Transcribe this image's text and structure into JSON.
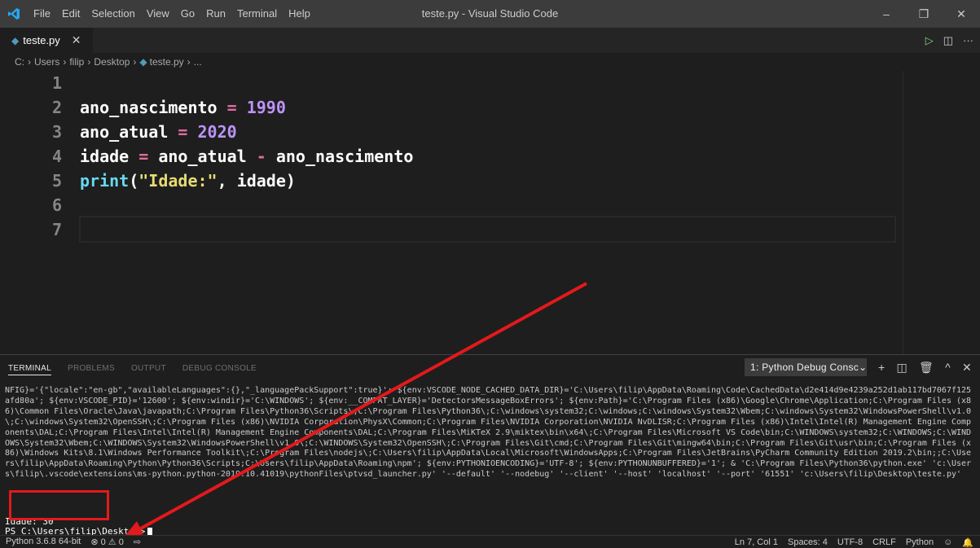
{
  "titlebar": {
    "menu": [
      "File",
      "Edit",
      "Selection",
      "View",
      "Go",
      "Run",
      "Terminal",
      "Help"
    ],
    "window_title": "teste.py - Visual Studio Code",
    "controls": {
      "minimize": "–",
      "maximize": "❐",
      "close": "✕"
    }
  },
  "tab": {
    "label": "teste.py",
    "close": "✕"
  },
  "editor_actions": {
    "run": "▷",
    "split": "◫",
    "more": "···"
  },
  "breadcrumb": [
    "C:",
    "Users",
    "filip",
    "Desktop",
    "teste.py",
    "..."
  ],
  "editor": {
    "line_numbers": [
      "1",
      "2",
      "3",
      "4",
      "5",
      "6",
      "7"
    ],
    "lines": [
      [],
      [
        {
          "t": "var",
          "v": "ano_nascimento "
        },
        {
          "t": "op",
          "v": "="
        },
        {
          "t": "var",
          "v": " "
        },
        {
          "t": "num",
          "v": "1990"
        }
      ],
      [
        {
          "t": "var",
          "v": "ano_atual "
        },
        {
          "t": "op",
          "v": "="
        },
        {
          "t": "var",
          "v": " "
        },
        {
          "t": "num",
          "v": "2020"
        }
      ],
      [
        {
          "t": "var",
          "v": "idade "
        },
        {
          "t": "op",
          "v": "="
        },
        {
          "t": "var",
          "v": " ano_atual "
        },
        {
          "t": "op",
          "v": "-"
        },
        {
          "t": "var",
          "v": " ano_nascimento"
        }
      ],
      [
        {
          "t": "fn",
          "v": "print"
        },
        {
          "t": "pun",
          "v": "("
        },
        {
          "t": "str",
          "v": "\"Idade:\""
        },
        {
          "t": "pun",
          "v": ", "
        },
        {
          "t": "var",
          "v": "idade"
        },
        {
          "t": "pun",
          "v": ")"
        }
      ],
      [],
      []
    ]
  },
  "panel": {
    "tabs": [
      "TERMINAL",
      "PROBLEMS",
      "OUTPUT",
      "DEBUG CONSOLE"
    ],
    "active_tab": "TERMINAL",
    "terminal_select": "1: Python Debug Consc",
    "actions": {
      "add": "+",
      "split": "◫",
      "trash": "🗑",
      "maximize": "^",
      "close": "✕"
    },
    "terminal_text": "NFIG}='{\"locale\":\"en-gb\",\"availableLanguages\":{},\"_languagePackSupport\":true}'; ${env:VSCODE_NODE_CACHED_DATA_DIR}='C:\\Users\\filip\\AppData\\Roaming\\Code\\CachedData\\d2e414d9e4239a252d1ab117bd7067f125afd80a'; ${env:VSCODE_PID}='12600'; ${env:windir}='C:\\WINDOWS'; ${env:__COMPAT_LAYER}='DetectorsMessageBoxErrors'; ${env:Path}='C:\\Program Files (x86)\\Google\\Chrome\\Application;C:\\Program Files (x86)\\Common Files\\Oracle\\Java\\javapath;C:\\Program Files\\Python36\\Scripts\\;C:\\Program Files\\Python36\\;C:\\windows\\system32;C:\\windows;C:\\windows\\System32\\Wbem;C:\\windows\\System32\\WindowsPowerShell\\v1.0\\;C:\\windows\\System32\\OpenSSH\\;C:\\Program Files (x86)\\NVIDIA Corporation\\PhysX\\Common;C:\\Program Files\\NVIDIA Corporation\\NVIDIA NvDLISR;C:\\Program Files (x86)\\Intel\\Intel(R) Management Engine Components\\DAL;C:\\Program Files\\Intel\\Intel(R) Management Engine Components\\DAL;C:\\Program Files\\MiKTeX 2.9\\miktex\\bin\\x64\\;C:\\Program Files\\Microsoft VS Code\\bin;C:\\WINDOWS\\system32;C:\\WINDOWS;C:\\WINDOWS\\System32\\Wbem;C:\\WINDOWS\\System32\\WindowsPowerShell\\v1.0\\;C:\\WINDOWS\\System32\\OpenSSH\\;C:\\Program Files\\Git\\cmd;C:\\Program Files\\Git\\mingw64\\bin;C:\\Program Files\\Git\\usr\\bin;C:\\Program Files (x86)\\Windows Kits\\8.1\\Windows Performance Toolkit\\;C:\\Program Files\\nodejs\\;C:\\Users\\filip\\AppData\\Local\\Microsoft\\WindowsApps;C:\\Program Files\\JetBrains\\PyCharm Community Edition 2019.2\\bin;;C:\\Users\\filip\\AppData\\Roaming\\Python\\Python36\\Scripts;C:\\Users\\filip\\AppData\\Roaming\\npm'; ${env:PYTHONIOENCODING}='UTF-8'; ${env:PYTHONUNBUFFERED}='1'; & 'C:\\Program Files\\Python36\\python.exe' 'c:\\Users\\filip\\.vscode\\extensions\\ms-python.python-2019.10.41019\\pythonFiles\\ptvsd_launcher.py' '--default' '--nodebug' '--client' '--host' 'localhost' '--port' '61551' 'c:\\Users\\filip\\Desktop\\teste.py'",
    "output_line": "Idade: 30",
    "prompt": "PS C:\\Users\\filip\\Desktop>"
  },
  "statusbar": {
    "left": [
      "Python 3.6.8 64-bit",
      "⊗ 0 ⚠ 0",
      "⇨"
    ],
    "right": [
      "Ln 7, Col 1",
      "Spaces: 4",
      "UTF-8",
      "CRLF",
      "Python",
      "☺",
      "🔔"
    ]
  },
  "colors": {
    "accent": "#007acc",
    "annotation_red": "#e3191c",
    "python_icon": "#519aba"
  }
}
